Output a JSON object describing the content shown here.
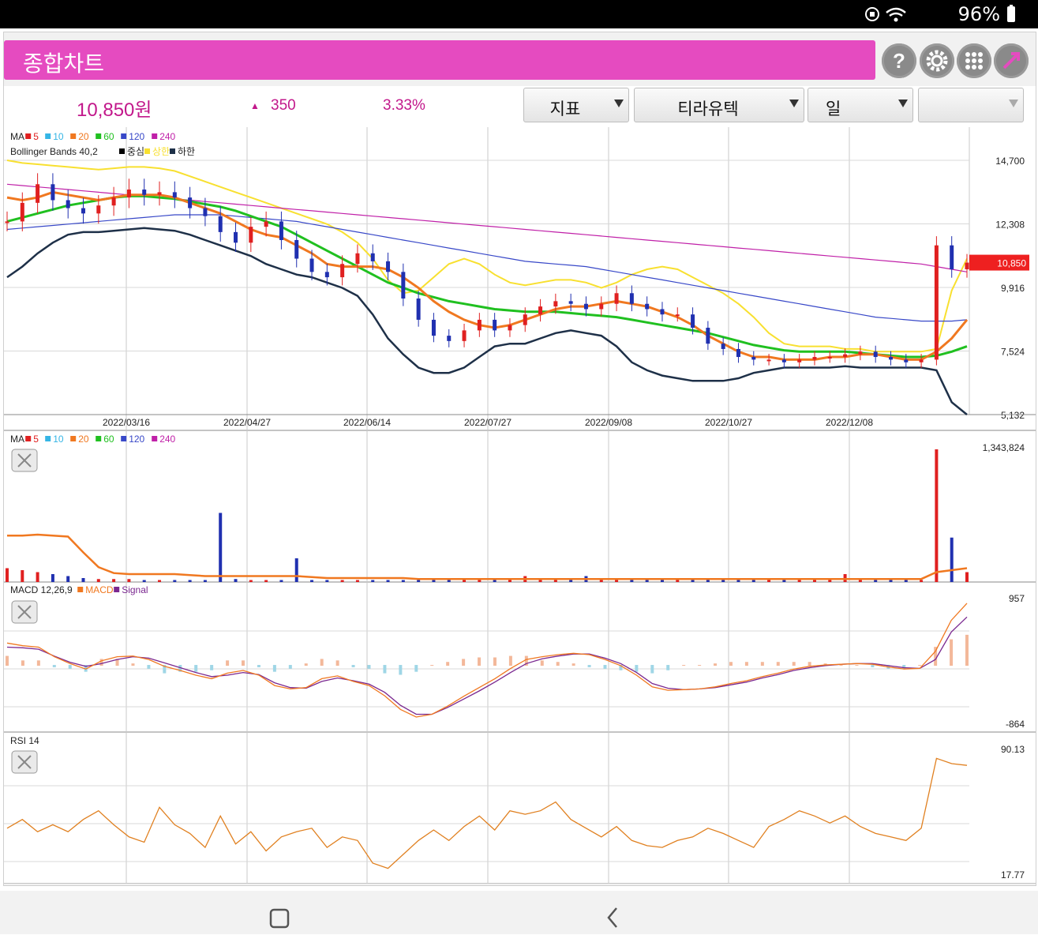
{
  "status_bar": {
    "battery": "96%",
    "icons": [
      "notification-icon",
      "wifi-icon",
      "battery-icon"
    ]
  },
  "header": {
    "title": "종합차트",
    "buttons": [
      "help-icon",
      "settings-icon",
      "grid-menu-icon",
      "expand-icon"
    ]
  },
  "quote": {
    "price": "10,850원",
    "change_arrow": "▲",
    "change": "350",
    "change_pct": "3.33%"
  },
  "dropdowns": {
    "indicator": "지표",
    "stock": "티라유텍",
    "period": "일",
    "extra": ""
  },
  "colors": {
    "brand": "#e54bc0",
    "price_text": "#c2188b",
    "up": "#e02020",
    "down": "#2030b0",
    "ma5": "#e02020",
    "ma10": "#35b5e5",
    "ma20": "#f07820",
    "ma60": "#20c020",
    "ma120": "#3848c8",
    "ma240": "#c020a8",
    "bb_mid": "#000000",
    "bb_upper": "#f8e030",
    "bb_lower": "#1e3048",
    "macd": "#f07820",
    "signal": "#7a2890",
    "rsi": "#e08020"
  },
  "price_panel": {
    "legend1": {
      "label": "MA",
      "items": [
        {
          "key": "ma5",
          "text": "5"
        },
        {
          "key": "ma10",
          "text": "10"
        },
        {
          "key": "ma20",
          "text": "20"
        },
        {
          "key": "ma60",
          "text": "60"
        },
        {
          "key": "ma120",
          "text": "120"
        },
        {
          "key": "ma240",
          "text": "240"
        }
      ]
    },
    "legend2": {
      "label": "Bollinger Bands 40,2",
      "items": [
        {
          "key": "bb_mid",
          "text": "중심"
        },
        {
          "key": "bb_upper",
          "text": "상한"
        },
        {
          "key": "bb_lower",
          "text": "하한"
        }
      ]
    },
    "y_labels": [
      "14,700",
      "12,308",
      "9,916",
      "7,524",
      "5,132"
    ],
    "current_price_tag": "10,850",
    "x_labels": [
      "2022/03/16",
      "2022/04/27",
      "2022/06/14",
      "2022/07/27",
      "2022/09/08",
      "2022/10/27",
      "2022/12/08"
    ]
  },
  "volume_panel": {
    "legend": {
      "label": "MA",
      "items": [
        {
          "key": "ma5",
          "text": "5"
        },
        {
          "key": "ma10",
          "text": "10"
        },
        {
          "key": "ma20",
          "text": "20"
        },
        {
          "key": "ma60",
          "text": "60"
        },
        {
          "key": "ma120",
          "text": "120"
        },
        {
          "key": "ma240",
          "text": "240"
        }
      ]
    },
    "y_max_label": "1,343,824"
  },
  "macd_panel": {
    "legend": {
      "label": "MACD 12,26,9",
      "items": [
        {
          "key": "macd",
          "text": "MACD"
        },
        {
          "key": "signal",
          "text": "Signal"
        }
      ]
    },
    "y_labels": [
      "957",
      "-864"
    ]
  },
  "rsi_panel": {
    "legend": {
      "label": "RSI 14"
    },
    "y_labels": [
      "90.13",
      "17.77"
    ]
  },
  "chart_data": [
    {
      "type": "candlestick",
      "title": "",
      "ylim": [
        5132,
        14700
      ],
      "yticks": [
        14700,
        12308,
        9916,
        7524,
        5132
      ],
      "x_tick_labels": [
        "2022/03/16",
        "2022/04/27",
        "2022/06/14",
        "2022/07/27",
        "2022/09/08",
        "2022/10/27",
        "2022/12/08"
      ],
      "last_price": 10850,
      "close": [
        12400,
        13100,
        13800,
        13200,
        12900,
        12700,
        13000,
        13300,
        13600,
        13400,
        13500,
        13300,
        12900,
        12600,
        12000,
        11600,
        12200,
        12400,
        11700,
        11000,
        10500,
        10300,
        10800,
        11200,
        10900,
        10500,
        9500,
        8700,
        8100,
        7900,
        8300,
        8700,
        8300,
        8500,
        8900,
        9200,
        9400,
        9300,
        9100,
        9300,
        9700,
        9300,
        9100,
        8900,
        8900,
        8400,
        7800,
        7600,
        7300,
        7200,
        7200,
        7100,
        7200,
        7300,
        7300,
        7400,
        7500,
        7300,
        7200,
        7100,
        7200,
        11500,
        10600,
        10850
      ],
      "ma20": [
        13300,
        13200,
        13300,
        13500,
        13400,
        13300,
        13200,
        13300,
        13400,
        13400,
        13400,
        13300,
        13100,
        12900,
        12700,
        12400,
        12100,
        11900,
        11800,
        11500,
        11200,
        10800,
        10700,
        10700,
        10700,
        10600,
        10300,
        9900,
        9400,
        9000,
        8700,
        8500,
        8400,
        8500,
        8700,
        8900,
        9100,
        9200,
        9200,
        9300,
        9400,
        9300,
        9200,
        9000,
        8800,
        8500,
        8100,
        7800,
        7500,
        7300,
        7300,
        7200,
        7200,
        7200,
        7300,
        7300,
        7400,
        7400,
        7300,
        7200,
        7200,
        7500,
        8000,
        8700
      ],
      "ma60": [
        12400,
        12550,
        12700,
        12850,
        13000,
        13100,
        13200,
        13300,
        13350,
        13350,
        13300,
        13250,
        13150,
        13050,
        12950,
        12800,
        12600,
        12400,
        12200,
        11900,
        11600,
        11300,
        11000,
        10700,
        10400,
        10100,
        9900,
        9700,
        9550,
        9400,
        9300,
        9200,
        9100,
        9050,
        9000,
        9000,
        9000,
        8950,
        8900,
        8850,
        8800,
        8700,
        8600,
        8500,
        8400,
        8300,
        8200,
        8050,
        7900,
        7750,
        7650,
        7550,
        7500,
        7500,
        7500,
        7500,
        7450,
        7400,
        7350,
        7300,
        7300,
        7350,
        7500,
        7700
      ],
      "ma240": [
        13800,
        13750,
        13700,
        13650,
        13600,
        13550,
        13500,
        13450,
        13400,
        13350,
        13300,
        13250,
        13200,
        13150,
        13100,
        13050,
        13000,
        12950,
        12900,
        12850,
        12800,
        12750,
        12700,
        12650,
        12600,
        12550,
        12500,
        12450,
        12400,
        12350,
        12300,
        12250,
        12200,
        12150,
        12100,
        12050,
        12000,
        11950,
        11900,
        11850,
        11800,
        11750,
        11700,
        11650,
        11600,
        11550,
        11500,
        11450,
        11400,
        11350,
        11300,
        11250,
        11200,
        11150,
        11100,
        11050,
        11000,
        10950,
        10900,
        10850,
        10800,
        10700,
        10600,
        10500
      ],
      "ma120": [
        12100,
        12150,
        12200,
        12250,
        12300,
        12350,
        12400,
        12450,
        12500,
        12550,
        12600,
        12650,
        12650,
        12650,
        12650,
        12600,
        12550,
        12500,
        12450,
        12400,
        12300,
        12200,
        12100,
        12000,
        11900,
        11800,
        11700,
        11600,
        11500,
        11400,
        11300,
        11200,
        11100,
        11000,
        10900,
        10850,
        10800,
        10750,
        10700,
        10600,
        10500,
        10400,
        10300,
        10200,
        10100,
        10000,
        9900,
        9800,
        9700,
        9600,
        9500,
        9400,
        9300,
        9200,
        9100,
        9000,
        8900,
        8800,
        8750,
        8700,
        8650,
        8650,
        8650,
        8700
      ],
      "bb_upper": [
        14700,
        14600,
        14550,
        14500,
        14450,
        14400,
        14350,
        14400,
        14450,
        14450,
        14400,
        14300,
        14100,
        13900,
        13700,
        13500,
        13300,
        13100,
        12900,
        12700,
        12500,
        12300,
        12000,
        11600,
        11000,
        10200,
        9700,
        9800,
        10300,
        10800,
        11000,
        10800,
        10400,
        10100,
        10000,
        10100,
        10200,
        10200,
        10100,
        9900,
        10100,
        10400,
        10600,
        10700,
        10600,
        10300,
        10000,
        9700,
        9300,
        8800,
        8200,
        7800,
        7700,
        7700,
        7700,
        7600,
        7600,
        7500,
        7500,
        7500,
        7500,
        7600,
        9800,
        11000
      ],
      "bb_lower": [
        10300,
        10700,
        11200,
        11600,
        11900,
        12000,
        12000,
        12050,
        12100,
        12150,
        12100,
        12050,
        11900,
        11700,
        11500,
        11300,
        11100,
        10800,
        10600,
        10400,
        10300,
        10100,
        9900,
        9600,
        8900,
        8000,
        7400,
        6900,
        6700,
        6700,
        6900,
        7300,
        7700,
        7800,
        7800,
        8000,
        8200,
        8300,
        8200,
        8100,
        7700,
        7100,
        6800,
        6600,
        6500,
        6400,
        6400,
        6400,
        6500,
        6700,
        6800,
        6900,
        6900,
        6900,
        6900,
        6950,
        6900,
        6900,
        6900,
        6900,
        6900,
        6800,
        5600,
        5132
      ]
    },
    {
      "type": "bar",
      "title": "",
      "ylim": [
        0,
        1343824
      ],
      "volume": [
        140000,
        120000,
        100000,
        80000,
        60000,
        40000,
        30000,
        30000,
        30000,
        20000,
        20000,
        20000,
        20000,
        20000,
        700000,
        30000,
        20000,
        20000,
        20000,
        240000,
        20000,
        20000,
        20000,
        20000,
        20000,
        20000,
        20000,
        20000,
        20000,
        20000,
        20000,
        20000,
        20000,
        30000,
        60000,
        20000,
        20000,
        20000,
        60000,
        20000,
        20000,
        20000,
        20000,
        20000,
        20000,
        20000,
        20000,
        20000,
        20000,
        40000,
        20000,
        40000,
        20000,
        20000,
        20000,
        80000,
        20000,
        20000,
        20000,
        20000,
        20000,
        1343824,
        450000,
        100000
      ],
      "vol_ma20": [
        470000,
        470000,
        480000,
        470000,
        460000,
        300000,
        150000,
        90000,
        80000,
        80000,
        80000,
        80000,
        70000,
        60000,
        60000,
        60000,
        60000,
        60000,
        60000,
        60000,
        50000,
        40000,
        40000,
        40000,
        40000,
        40000,
        40000,
        30000,
        30000,
        30000,
        30000,
        30000,
        30000,
        30000,
        30000,
        30000,
        30000,
        30000,
        30000,
        30000,
        30000,
        30000,
        30000,
        30000,
        30000,
        30000,
        30000,
        30000,
        30000,
        30000,
        30000,
        30000,
        30000,
        30000,
        30000,
        30000,
        30000,
        30000,
        30000,
        30000,
        30000,
        100000,
        120000,
        140000
      ]
    },
    {
      "type": "line",
      "title": "",
      "ylim": [
        -864,
        957
      ],
      "series": [
        {
          "name": "MACD",
          "values": [
            320,
            280,
            260,
            120,
            20,
            -60,
            60,
            120,
            130,
            80,
            -20,
            -80,
            -150,
            -200,
            -120,
            -80,
            -150,
            -300,
            -350,
            -330,
            -200,
            -160,
            -240,
            -300,
            -450,
            -650,
            -760,
            -720,
            -600,
            -460,
            -330,
            -200,
            -50,
            80,
            120,
            150,
            170,
            150,
            80,
            -10,
            -150,
            -320,
            -370,
            -360,
            -350,
            -320,
            -270,
            -230,
            -170,
            -120,
            -60,
            -20,
            0,
            10,
            20,
            10,
            -30,
            -60,
            -50,
            200,
            650,
            900
          ]
        },
        {
          "name": "Signal",
          "values": [
            260,
            250,
            230,
            130,
            40,
            -20,
            20,
            80,
            120,
            100,
            30,
            -40,
            -110,
            -170,
            -150,
            -110,
            -140,
            -260,
            -330,
            -340,
            -240,
            -190,
            -230,
            -280,
            -400,
            -590,
            -720,
            -720,
            -620,
            -500,
            -380,
            -250,
            -110,
            20,
            90,
            130,
            160,
            160,
            100,
            20,
            -110,
            -270,
            -340,
            -360,
            -350,
            -330,
            -290,
            -250,
            -190,
            -140,
            -80,
            -40,
            -10,
            10,
            20,
            20,
            -10,
            -40,
            -50,
            80,
            480,
            700
          ]
        }
      ]
    },
    {
      "type": "line",
      "title": "",
      "ylim": [
        17.77,
        90.13
      ],
      "series": [
        {
          "name": "RSI 14",
          "values": [
            45,
            50,
            43,
            47,
            43,
            50,
            55,
            47,
            40,
            37,
            57,
            47,
            42,
            34,
            52,
            36,
            43,
            32,
            40,
            43,
            45,
            34,
            40,
            38,
            25,
            22,
            30,
            38,
            44,
            38,
            46,
            52,
            44,
            55,
            53,
            55,
            60,
            50,
            45,
            40,
            46,
            38,
            35,
            34,
            38,
            40,
            45,
            42,
            38,
            34,
            46,
            50,
            55,
            52,
            48,
            52,
            46,
            42,
            40,
            38,
            45,
            85,
            82,
            81
          ]
        }
      ]
    }
  ]
}
